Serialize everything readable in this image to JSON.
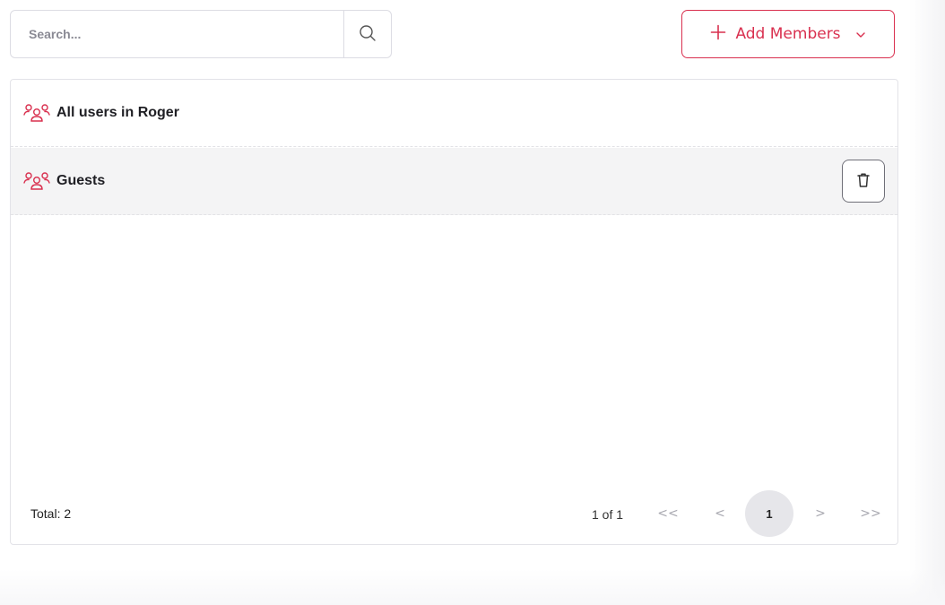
{
  "search": {
    "placeholder": "Search...",
    "icon": "search-icon"
  },
  "toolbar": {
    "add_label": "Add Members",
    "accent": "#d9304f"
  },
  "groups": [
    {
      "name": "All users in Roger",
      "icon": "users-group-icon",
      "deletable": false
    },
    {
      "name": "Guests",
      "icon": "users-group-icon",
      "deletable": true
    }
  ],
  "footer": {
    "total": "Total: 2",
    "page_info": "1 of 1",
    "first": "<<",
    "prev": "<",
    "current": "1",
    "next": ">",
    "last": ">>"
  }
}
